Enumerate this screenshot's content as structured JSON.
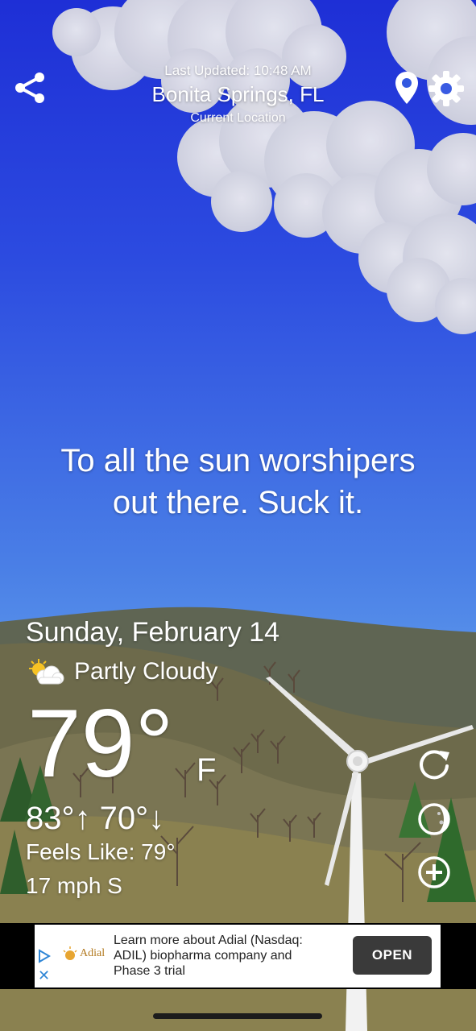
{
  "header": {
    "last_updated": "Last Updated: 10:48 AM",
    "city": "Bonita Springs, FL",
    "location_label": "Current Location"
  },
  "icons": {
    "share": "share-icon",
    "location": "location-pin-icon",
    "settings": "gear-icon",
    "refresh": "refresh-icon",
    "moon": "moon-phase-icon",
    "add": "plus-circle-icon",
    "condition": "partly-cloudy-icon"
  },
  "quote": {
    "line1": "To all the sun worshipers",
    "line2": "out there. Suck it."
  },
  "weather": {
    "date": "Sunday, February 14",
    "condition": "Partly Cloudy",
    "temp": "79°",
    "unit": "F",
    "hilo": "83°↑ 70°↓",
    "feels_like": "Feels Like: 79°",
    "wind": "17 mph S"
  },
  "ad": {
    "brand": "Adial",
    "text": "Learn more about Adial (Nasdaq: ADIL) biopharma company and Phase 3 trial",
    "button": "OPEN",
    "close_glyph": "✕"
  },
  "colors": {
    "sky_top": "#1e2fd6",
    "sky_bottom": "#7fbcf3",
    "hills": "#6b6a47",
    "ad_button": "#3a3a3a"
  }
}
